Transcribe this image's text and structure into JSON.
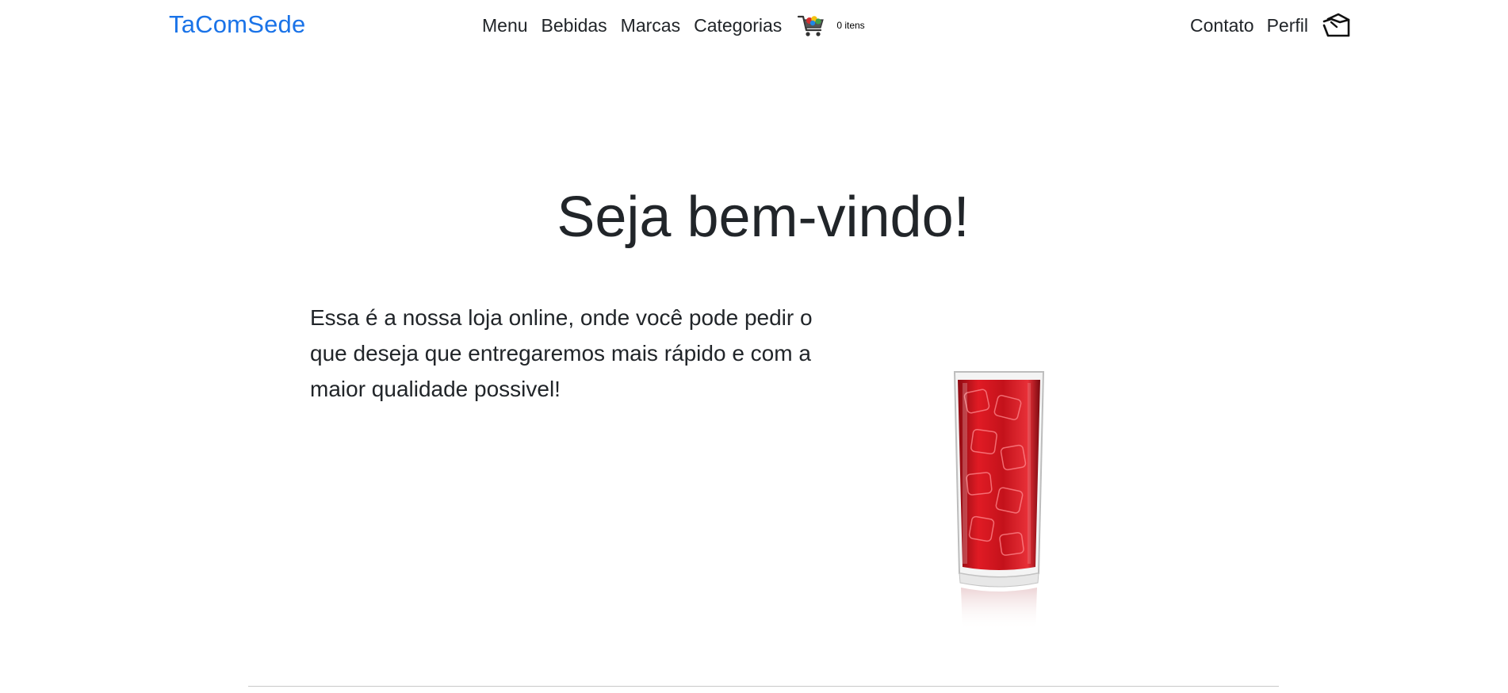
{
  "navbar": {
    "brand": "TaComSede",
    "links": [
      "Menu",
      "Bebidas",
      "Marcas",
      "Categorias"
    ],
    "cart_count": "0 itens",
    "cart_icon": "shopping-cart-icon",
    "right_links": [
      "Contato",
      "Perfil"
    ],
    "logout_icon": "logout-icon"
  },
  "hero": {
    "title": "Seja bem-vindo!",
    "text": "Essa é a nossa loja online, onde você pode pedir o que deseja que entregaremos mais rápido e com a maior qualidade possivel!"
  },
  "image": {
    "icon": "red-drink-glass-image"
  },
  "colors": {
    "brand": "#1a73e8",
    "text": "#212529",
    "drink": "#d3121c"
  }
}
